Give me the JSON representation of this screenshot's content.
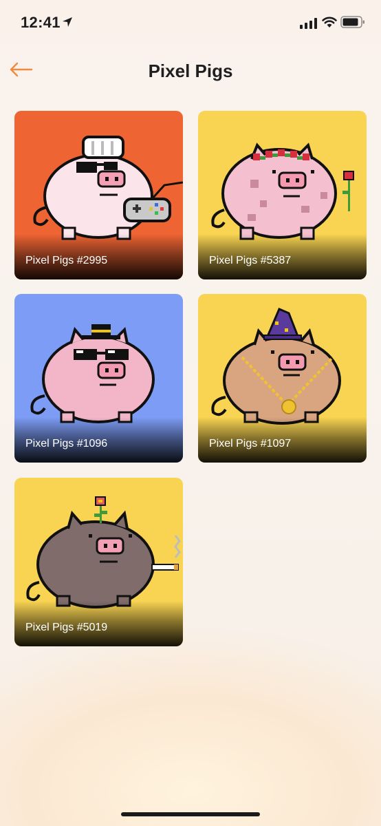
{
  "status_bar": {
    "time": "12:41",
    "icons": [
      "location-arrow-icon",
      "cellular-signal-icon",
      "wifi-icon",
      "battery-icon"
    ]
  },
  "header": {
    "title": "Pixel Pigs",
    "back_icon": "arrow-left-icon",
    "accent_color": "#f08a3c"
  },
  "cards": [
    {
      "label": "Pixel Pigs #2995",
      "background": "#ee6433",
      "pig_color": "#fbe4ea",
      "accessory": "chef hat, sunglasses, game controller"
    },
    {
      "label": "Pixel Pigs #5387",
      "background": "#f9d452",
      "pig_color": "#f4bfcf",
      "accessory": "flower crown, rose"
    },
    {
      "label": "Pixel Pigs #1096",
      "background": "#7d9cf5",
      "pig_color": "#f3b6c8",
      "accessory": "bowler hat, sunglasses"
    },
    {
      "label": "Pixel Pigs #1097",
      "background": "#f9d452",
      "pig_color": "#d9a581",
      "accessory": "wizard hat, gold chain"
    },
    {
      "label": "Pixel Pigs #5019",
      "background": "#f9d452",
      "pig_color": "#7f6c6b",
      "accessory": "flower sprout, cigarette"
    }
  ]
}
